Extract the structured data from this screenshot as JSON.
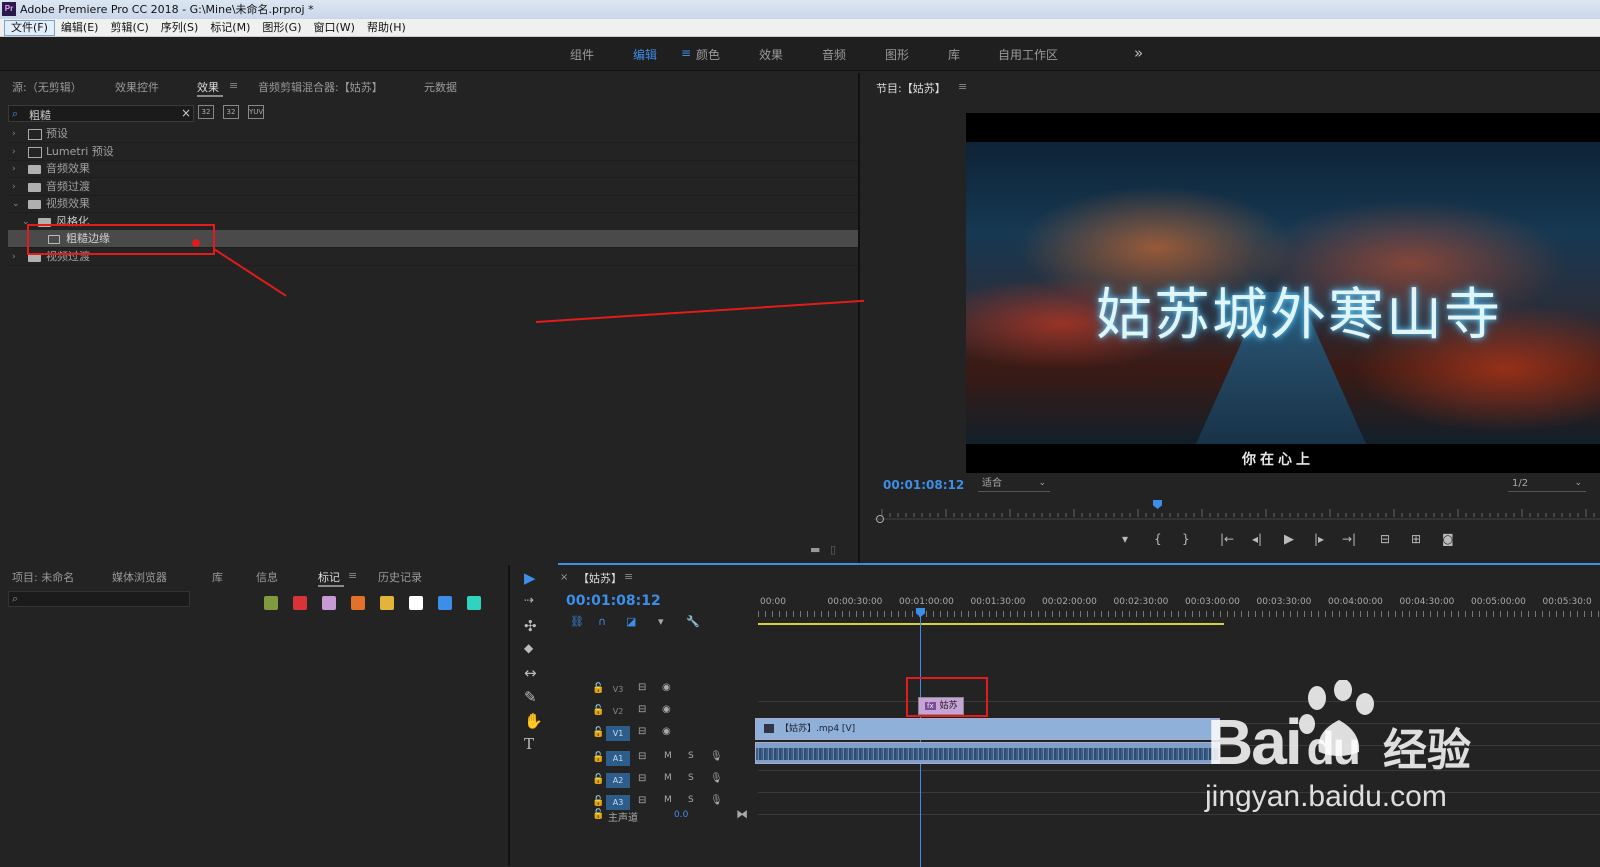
{
  "titlebar": {
    "title": "Adobe Premiere Pro CC 2018 - G:\\Mine\\未命名.prproj *",
    "logo": "Pr"
  },
  "menu": [
    "文件(F)",
    "编辑(E)",
    "剪辑(C)",
    "序列(S)",
    "标记(M)",
    "图形(G)",
    "窗口(W)",
    "帮助(H)"
  ],
  "workspaces": {
    "items": [
      "组件",
      "编辑",
      "颜色",
      "效果",
      "音频",
      "图形",
      "库",
      "自用工作区"
    ],
    "active": "编辑",
    "menu_glyph": "≡",
    "more": "»"
  },
  "effects_panel": {
    "tabs": [
      "源:（无剪辑）",
      "效果控件",
      "效果",
      "音频剪辑混合器:【姑苏】",
      "元数据"
    ],
    "active_tab": "效果",
    "menu_glyph": "≡",
    "search_value": "粗糙",
    "clear": "×",
    "toolbar_icons": [
      "32",
      "32",
      "YUV"
    ],
    "tree": [
      {
        "label": "预设",
        "chev": "›"
      },
      {
        "label": "Lumetri 预设",
        "chev": "›"
      },
      {
        "label": "音频效果",
        "chev": "›"
      },
      {
        "label": "音频过渡",
        "chev": "›"
      },
      {
        "label": "视频效果",
        "chev": "⌄"
      },
      {
        "label": "风格化",
        "chev": "⌄"
      },
      {
        "label": "粗糙边缘",
        "chev": ""
      },
      {
        "label": "视频过渡",
        "chev": "›"
      }
    ]
  },
  "program_panel": {
    "title": "节目:【姑苏】",
    "menu_glyph": "≡",
    "video_title": "姑苏城外寒山寺",
    "subtitle": "你在心上",
    "timecode": "00:01:08:12",
    "fit": "适合",
    "resolution": "1/2",
    "controls": [
      "▾",
      "{",
      "}",
      "|←",
      "◂|",
      "▶",
      "|▸",
      "→|",
      "⊟",
      "⊞",
      "◙"
    ]
  },
  "project_panel": {
    "tabs": [
      "项目: 未命名",
      "媒体浏览器",
      "库",
      "信息",
      "标记",
      "历史记录"
    ],
    "active_tab": "标记",
    "menu_glyph": "≡",
    "swatch_colors": [
      "#7f9b3d",
      "#d9333a",
      "#c79ad5",
      "#e2722a",
      "#e2b43a",
      "#ffffff",
      "#3d8ee8",
      "#2fd3c0"
    ]
  },
  "tools": [
    "▶",
    "⇢",
    "✣",
    "◆",
    "↔",
    "✎",
    "✋",
    "T"
  ],
  "timeline": {
    "title": "【姑苏】",
    "menu_glyph": "≡",
    "close": "×",
    "timecode": "00:01:08:12",
    "ruler": [
      "00:00",
      "00:00:30:00",
      "00:01:00:00",
      "00:01:30:00",
      "00:02:00:00",
      "00:02:30:00",
      "00:03:00:00",
      "00:03:30:00",
      "00:04:00:00",
      "00:04:30:00",
      "00:05:00:00",
      "00:05:30:0"
    ],
    "tracks": [
      {
        "name": "V3",
        "on": false,
        "type": "video"
      },
      {
        "name": "V2",
        "on": false,
        "type": "video"
      },
      {
        "name": "V1",
        "on": true,
        "type": "video"
      },
      {
        "name": "A1",
        "on": true,
        "type": "audio"
      },
      {
        "name": "A2",
        "on": true,
        "type": "audio"
      },
      {
        "name": "A3",
        "on": true,
        "type": "audio"
      }
    ],
    "master": {
      "label": "主声道",
      "value": "0.0"
    },
    "title_clip": "姑苏",
    "video_clip": "【姑苏】.mp4 [V]",
    "track_glyphs": {
      "lock": "🔓",
      "toggle": "⊟",
      "eye": "◉",
      "mute": "M",
      "solo": "S",
      "mic": "🎙"
    }
  },
  "watermark": {
    "bai": "Bai",
    "du": "du",
    "jingyan": "经验",
    "url": "jingyan.baidu.com"
  }
}
